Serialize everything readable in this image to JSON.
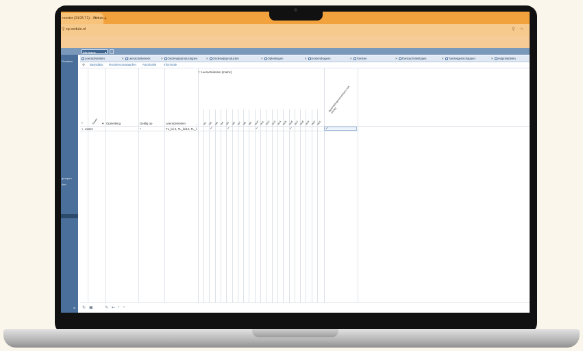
{
  "browser": {
    "tab_title": "rooster (24/25 T1) - Xedule",
    "tab_close": "×",
    "new_tab": "+",
    "url": "sp.xedule.nl",
    "lock_icon": "lock-icon",
    "zoom_icon": "zoom-icon",
    "star_icon": "star-icon"
  },
  "app": {
    "filter_select": "Alle teams",
    "sidebar_labels": [
      "Roosters",
      "groepen",
      "den"
    ],
    "doc_tabs": [
      "Leeractiviteiten",
      "Leeractiviteitsets",
      "Onderwijsproducttypes",
      "Onderwijsproducten",
      "Opleidingen",
      "Kostendragers",
      "Toetsen",
      "Toetsactiviteittypes",
      "Toetseigenschappen",
      "Hulpmiddelen"
    ],
    "sub_tabs": [
      "Basisdata",
      "Roostervoorwaarden",
      "Autorisatie",
      "Informatie"
    ],
    "grid": {
      "group_header": "Leeractiviteiten (matrix)",
      "columns": [
        "Naam",
        "Opmerking",
        "Geldig op",
        "Leeractiviteiten"
      ],
      "matrix_columns": [
        "la1",
        "la2",
        "la3",
        "la4",
        "la5",
        "la6",
        "la7",
        "la8",
        "la9",
        "la10",
        "la11",
        "la12",
        "la13",
        "la14",
        "la15",
        "la16",
        "la17",
        "la18",
        "la19",
        "la20",
        "la21"
      ],
      "last_matrix_column": "Beoordelingsmoment(en) met uitslag",
      "row": {
        "index": "1",
        "name": "extern",
        "opmerking": "",
        "geldig_op": "*",
        "leeractiviteiten": "TL_lei 2, TL_lei12, TL_l"
      }
    },
    "statusbar": {
      "icons": [
        "refresh-icon",
        "save-icon",
        "edit-icon",
        "first-icon",
        "prev-icon",
        "next-icon"
      ]
    }
  },
  "colors": {
    "browser_chrome": "#f2a23c",
    "sidebar": "#4a6f9a",
    "accent_link": "#3b6fa6"
  }
}
